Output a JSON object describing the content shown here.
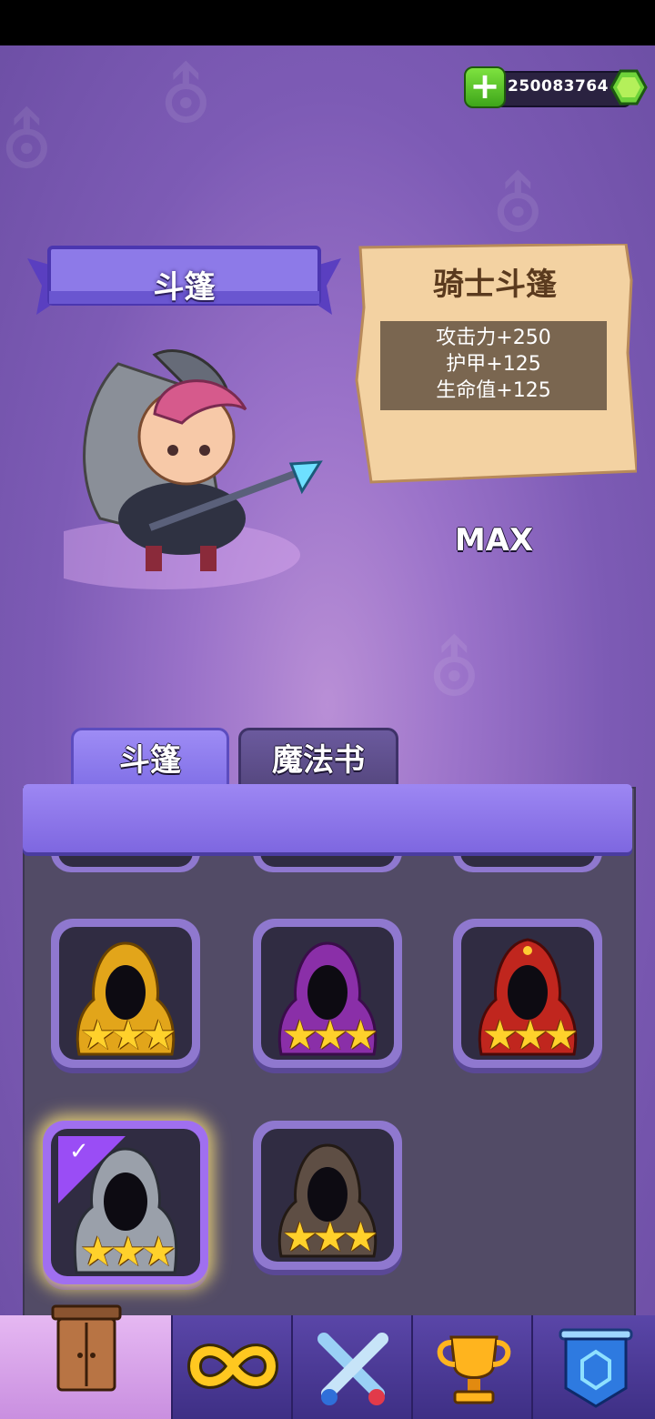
{
  "currency": {
    "amount": "250083764",
    "plus_icon": "plus-icon",
    "gem_icon": "green-gem-icon",
    "gem_color": "#7ee23f"
  },
  "equipment": {
    "category_title": "斗篷",
    "item_name": "骑士斗篷",
    "stats": [
      "攻击力+250",
      "护甲+125",
      "生命值+125"
    ],
    "level": "MAX"
  },
  "tabs": [
    {
      "label": "斗篷",
      "active": true
    },
    {
      "label": "魔法书",
      "active": false
    }
  ],
  "cloaks": [
    {
      "name": "gold-cloak",
      "color": "#e2a51a",
      "stars": "★★★"
    },
    {
      "name": "purple-cloak",
      "color": "#8a2fa8",
      "stars": "★★★"
    },
    {
      "name": "red-cloak",
      "color": "#c0261e",
      "stars": "★★★"
    },
    {
      "name": "knight-cloak",
      "color": "#9aa0aa",
      "stars": "★★★",
      "selected": true
    },
    {
      "name": "brown-cloak",
      "color": "#5e4e44",
      "stars": "★★★"
    }
  ],
  "nav": [
    {
      "icon": "wardrobe-icon",
      "active": true
    },
    {
      "icon": "infinity-icon"
    },
    {
      "icon": "crossed-swords-icon"
    },
    {
      "icon": "trophy-icon"
    },
    {
      "icon": "shield-banner-icon"
    }
  ]
}
